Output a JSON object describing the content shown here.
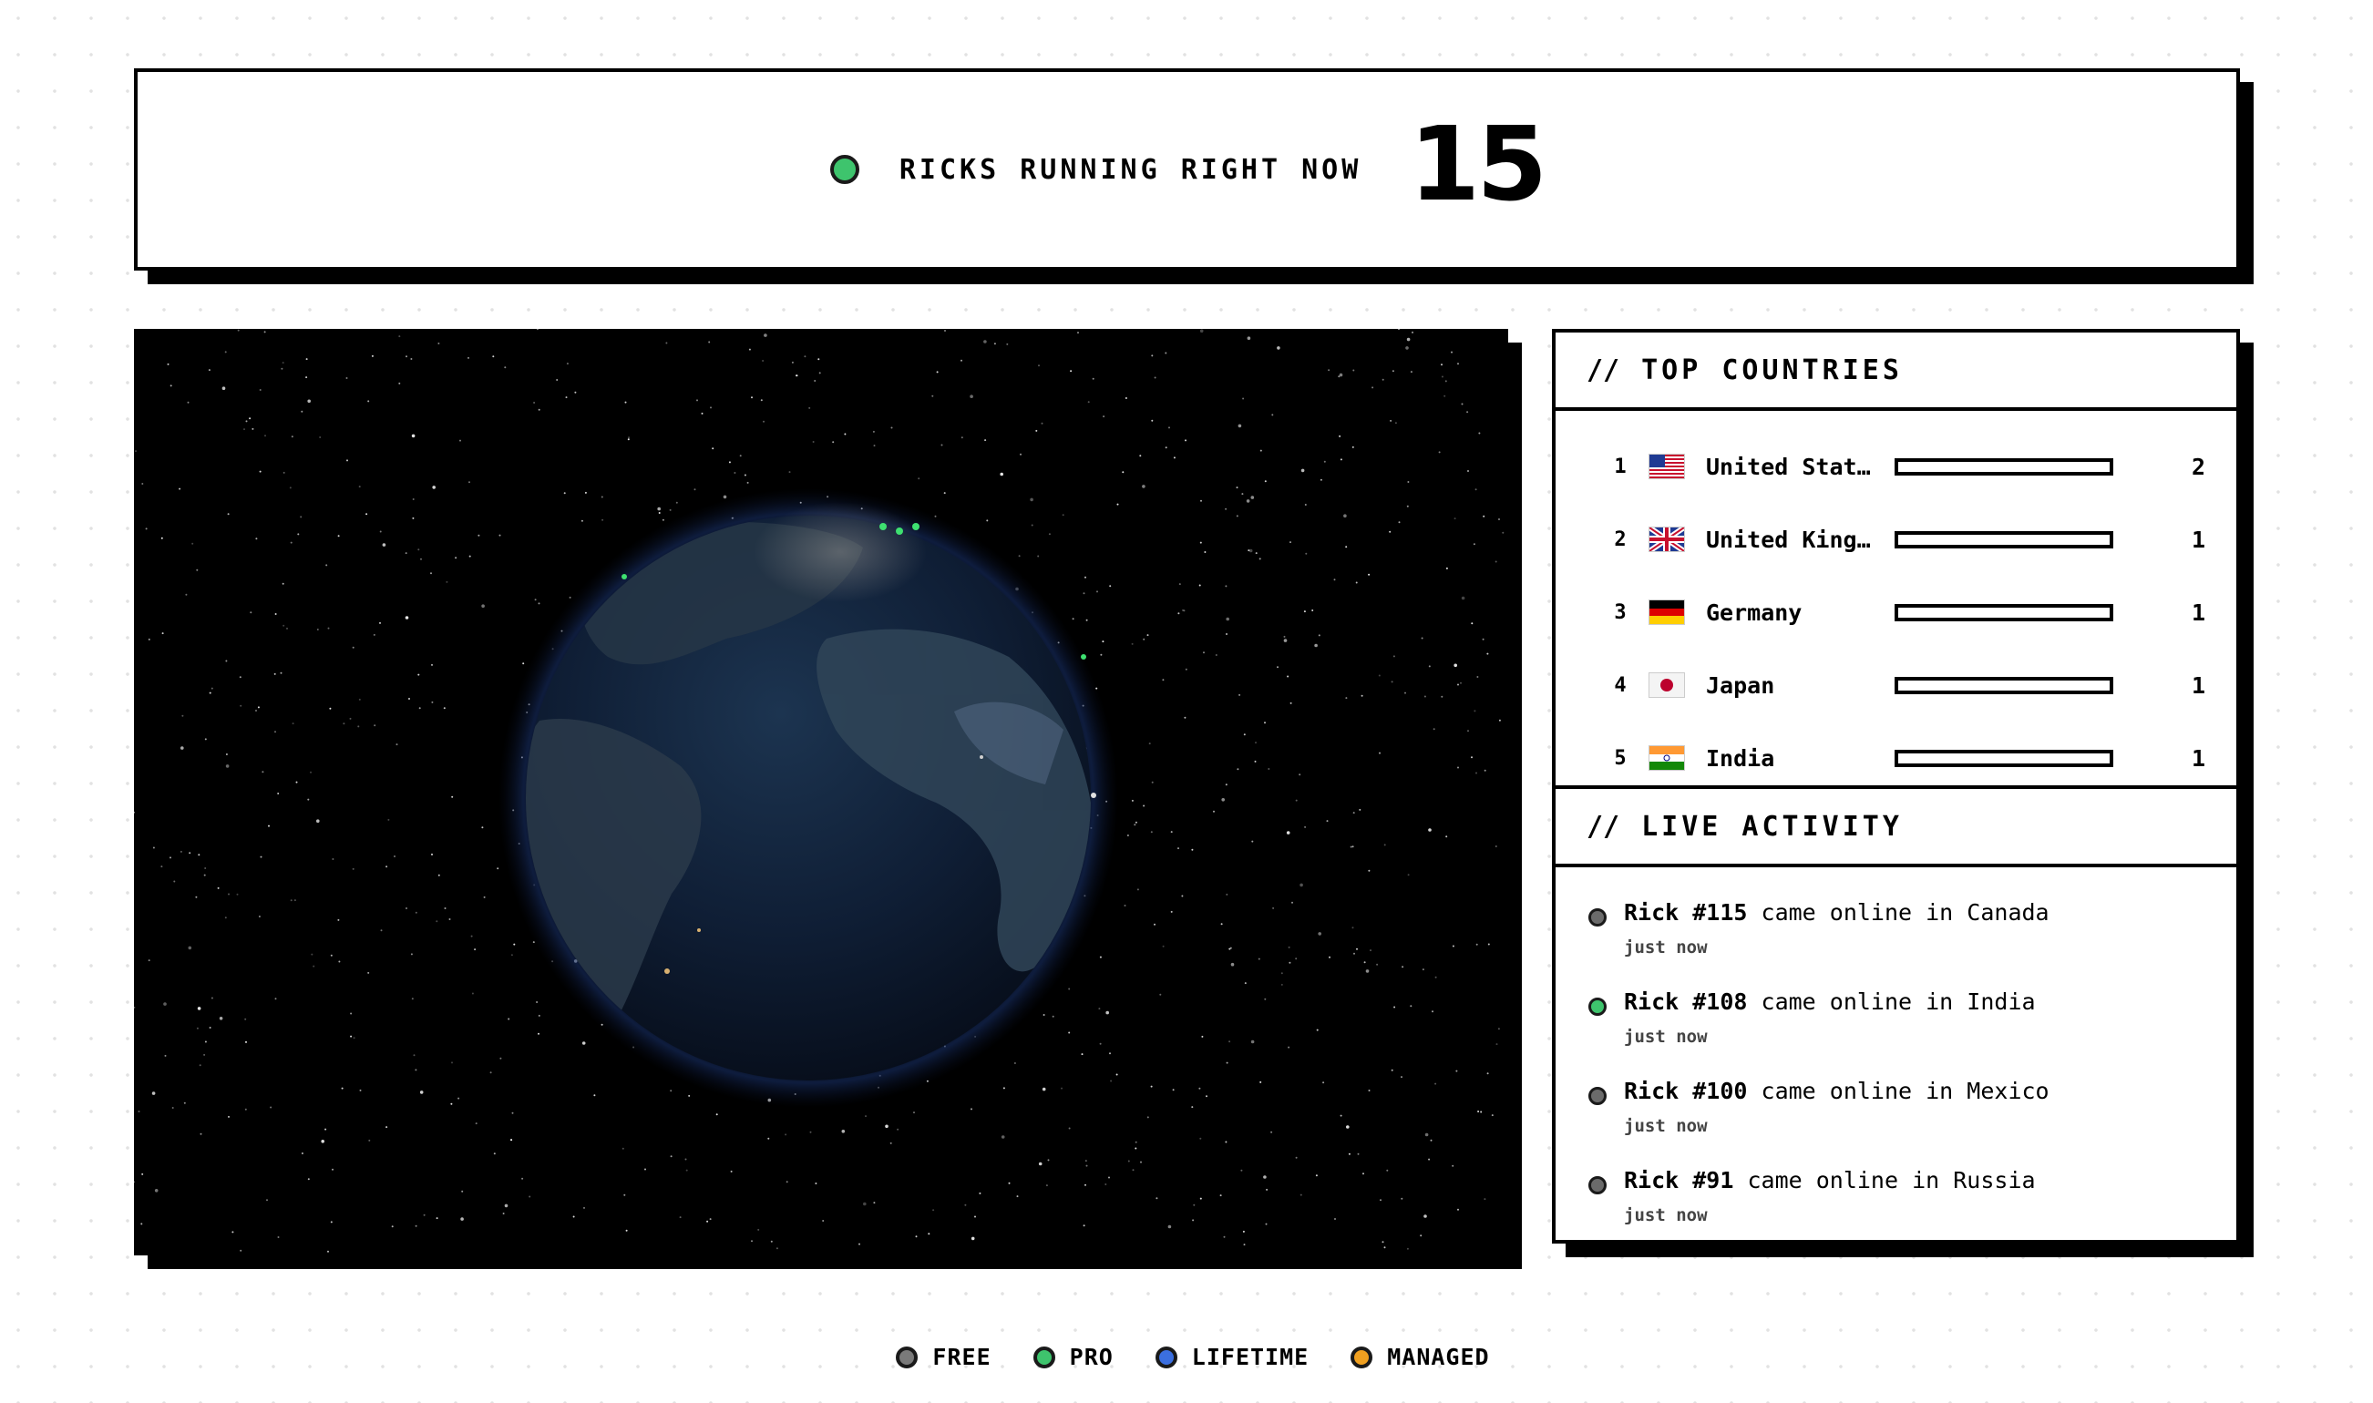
{
  "header": {
    "label": "RICKS RUNNING RIGHT NOW",
    "count": "15",
    "status_color": "#3ec46d"
  },
  "globe": {
    "description_icon": "earth-globe"
  },
  "top_countries": {
    "slashes": "//",
    "title": "TOP COUNTRIES",
    "max_count": 2,
    "items": [
      {
        "rank": "1",
        "flag": "us-flag",
        "name": "United Stat…",
        "count": "2",
        "value": 2
      },
      {
        "rank": "2",
        "flag": "uk-flag",
        "name": "United King…",
        "count": "1",
        "value": 1
      },
      {
        "rank": "3",
        "flag": "de-flag",
        "name": "Germany",
        "count": "1",
        "value": 1
      },
      {
        "rank": "4",
        "flag": "jp-flag",
        "name": "Japan",
        "count": "1",
        "value": 1
      },
      {
        "rank": "5",
        "flag": "in-flag",
        "name": "India",
        "count": "1",
        "value": 1
      }
    ]
  },
  "live_activity": {
    "slashes": "//",
    "title": "LIVE ACTIVITY",
    "items": [
      {
        "rick": "Rick #115",
        "text": " came online in Canada",
        "time": "just now",
        "tier": "free",
        "color": "#6b6b6b"
      },
      {
        "rick": "Rick #108",
        "text": " came online in India",
        "time": "just now",
        "tier": "pro",
        "color": "#3ec46d"
      },
      {
        "rick": "Rick #100",
        "text": " came online in Mexico",
        "time": "just now",
        "tier": "free",
        "color": "#6b6b6b"
      },
      {
        "rick": "Rick #91",
        "text": " came online in Russia",
        "time": "just now",
        "tier": "free",
        "color": "#6b6b6b"
      }
    ]
  },
  "legend": [
    {
      "label": "FREE",
      "color": "#7a7a7a"
    },
    {
      "label": "PRO",
      "color": "#3ec46d"
    },
    {
      "label": "LIFETIME",
      "color": "#3b6fe0"
    },
    {
      "label": "MANAGED",
      "color": "#f0a020"
    }
  ]
}
